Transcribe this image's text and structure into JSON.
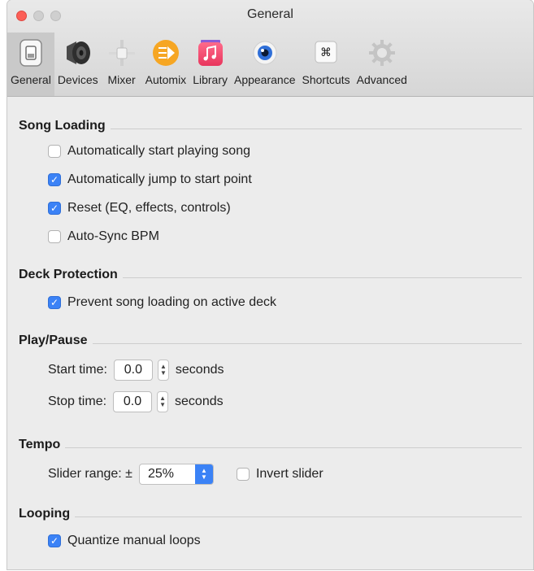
{
  "window": {
    "title": "General"
  },
  "toolbar": [
    {
      "label": "General",
      "icon": "switch-icon",
      "selected": true
    },
    {
      "label": "Devices",
      "icon": "speaker-icon",
      "selected": false
    },
    {
      "label": "Mixer",
      "icon": "fader-icon",
      "selected": false
    },
    {
      "label": "Automix",
      "icon": "automix-icon",
      "selected": false
    },
    {
      "label": "Library",
      "icon": "music-library-icon",
      "selected": false
    },
    {
      "label": "Appearance",
      "icon": "eye-icon",
      "selected": false
    },
    {
      "label": "Shortcuts",
      "icon": "command-key-icon",
      "selected": false
    },
    {
      "label": "Advanced",
      "icon": "gear-icon",
      "selected": false
    }
  ],
  "sections": {
    "song_loading": {
      "heading": "Song Loading",
      "options": [
        {
          "label": "Automatically start playing song",
          "checked": false
        },
        {
          "label": "Automatically jump to start point",
          "checked": true
        },
        {
          "label": "Reset (EQ, effects, controls)",
          "checked": true
        },
        {
          "label": "Auto-Sync BPM",
          "checked": false
        }
      ]
    },
    "deck_protection": {
      "heading": "Deck Protection",
      "options": [
        {
          "label": "Prevent song loading on active deck",
          "checked": true
        }
      ]
    },
    "play_pause": {
      "heading": "Play/Pause",
      "start_label": "Start time:",
      "start_value": "0.0",
      "stop_label": "Stop time:",
      "stop_value": "0.0",
      "unit": "seconds"
    },
    "tempo": {
      "heading": "Tempo",
      "range_label": "Slider range: ±",
      "range_value": "25%",
      "invert_label": "Invert slider",
      "invert_checked": false
    },
    "looping": {
      "heading": "Looping",
      "options": [
        {
          "label": "Quantize manual loops",
          "checked": true
        }
      ]
    }
  },
  "colors": {
    "accent": "#3b82f6",
    "window_bg": "#ececec",
    "selected_tab": "#c9c9c9"
  }
}
